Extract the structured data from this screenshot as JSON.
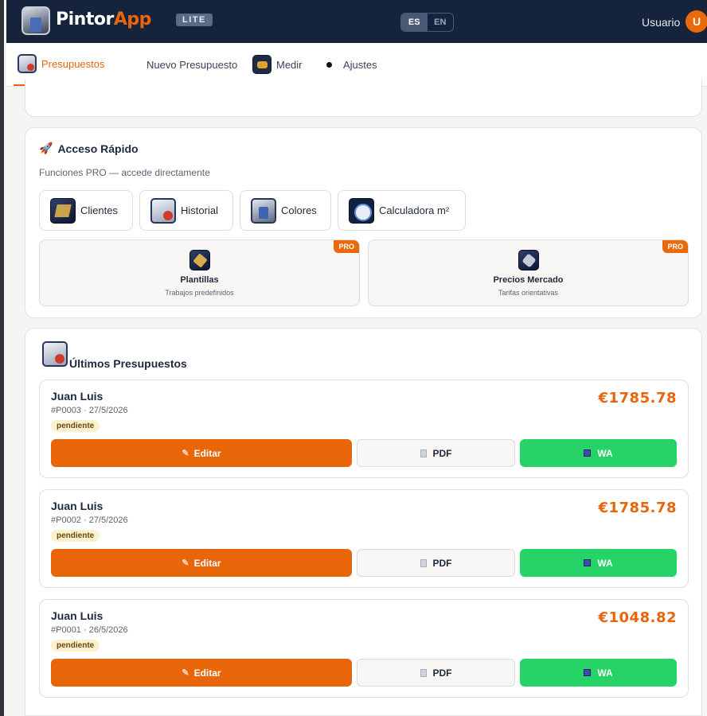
{
  "header": {
    "brand_main": "Pintor",
    "brand_accent": "App",
    "edition_badge": "LITE",
    "languages": [
      "ES",
      "EN"
    ],
    "active_language": "ES",
    "user_label": "Usuario",
    "avatar_initial": "U"
  },
  "nav": {
    "tabs": [
      {
        "label": "Presupuestos",
        "icon": "document-icon",
        "active": true
      },
      {
        "label": "Nuevo Presupuesto",
        "icon": "",
        "active": false
      },
      {
        "label": "Medir",
        "icon": "tape-measure-icon",
        "active": false
      },
      {
        "label": "Ajustes",
        "icon": "bullet-icon",
        "active": false
      }
    ]
  },
  "quick_access": {
    "title": "Acceso Rápido",
    "subtitle": "Funciones PRO — accede directamente",
    "buttons": [
      {
        "label": "Clientes",
        "icon": "book-icon"
      },
      {
        "label": "Historial",
        "icon": "history-icon"
      },
      {
        "label": "Colores",
        "icon": "paint-bucket-icon"
      },
      {
        "label": "Calculadora m²",
        "icon": "calculator-icon"
      }
    ],
    "pro_cards": [
      {
        "badge": "PRO",
        "name": "Plantillas",
        "description": "Trabajos predefinidos",
        "icon": "hammer-icon"
      },
      {
        "badge": "PRO",
        "name": "Precios Mercado",
        "description": "Tarifas orientativas",
        "icon": "price-tag-icon"
      }
    ]
  },
  "latest": {
    "title": "Últimos Presupuestos",
    "items": [
      {
        "client": "Juan Luis",
        "meta": "#P0003 · 27/5/2026",
        "status": "pendiente",
        "amount": "€1785.78"
      },
      {
        "client": "Juan Luis",
        "meta": "#P0002 · 27/5/2026",
        "status": "pendiente",
        "amount": "€1785.78"
      },
      {
        "client": "Juan Luis",
        "meta": "#P0001 · 26/5/2026",
        "status": "pendiente",
        "amount": "€1048.82"
      }
    ],
    "actions": {
      "edit": "Editar",
      "pdf": "PDF",
      "wa": "WA"
    }
  },
  "colors": {
    "accent": "#e8650a",
    "header_bg": "#16233d",
    "whatsapp": "#25d366"
  }
}
